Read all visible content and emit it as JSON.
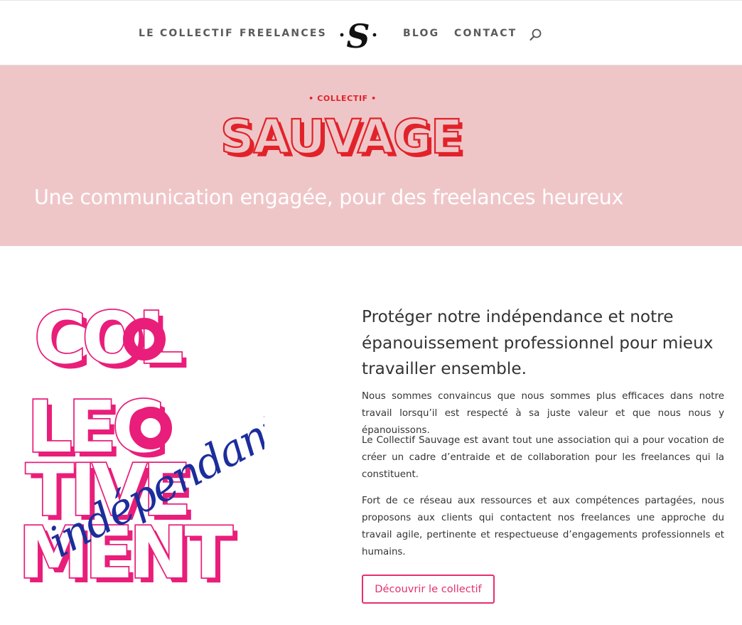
{
  "nav": {
    "items": [
      {
        "label": "LE COLLECTIF"
      },
      {
        "label": "FREELANCES"
      },
      {
        "label": "BLOG"
      },
      {
        "label": "CONTACT"
      }
    ],
    "logo_icon": "s-monogram-logo",
    "search_icon": "search-icon"
  },
  "hero": {
    "logo": {
      "small_text": "• COLLECTIF •",
      "big_text": "SAUVAGE",
      "color": "#e2222a"
    },
    "tagline": "Une communication engagée, pour des freelances heureux",
    "background": "#efc6c8"
  },
  "artwork": {
    "lines": [
      "COL",
      "LEC",
      "TIVE",
      "MENT"
    ],
    "script_text": "indépendants",
    "pink": "#e91e7a",
    "blue": "#1c2d9c"
  },
  "content": {
    "title": "Protéger notre indépendance et notre épanouissement professionnel pour mieux travailler ensemble.",
    "paragraphs": [
      "Nous sommes convaincus que nous sommes plus efficaces dans notre travail lorsqu’il est respecté à sa juste valeur et que nous nous y épanouissons.",
      "Le Collectif Sauvage est avant tout une association qui a pour vocation de créer un cadre d’entraide et de collaboration pour les freelances qui la constituent.",
      "Fort de ce réseau aux ressources et aux compétences partagées, nous proposons aux clients qui contactent nos freelances une approche du travail agile, pertinente et respectueuse d’engagements professionnels et humains."
    ],
    "cta_label": "Découvrir le collectif",
    "accent": "#e5306e"
  }
}
